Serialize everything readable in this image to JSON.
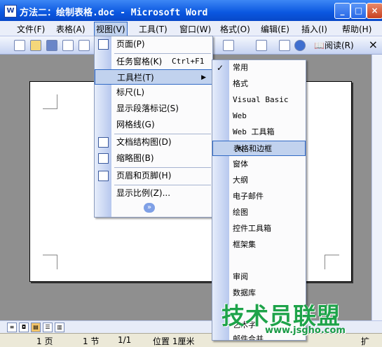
{
  "window": {
    "title": "方法二：绘制表格.doc - Microsoft Word",
    "app_icon": "W"
  },
  "menubar": [
    "文件(F)",
    "表格(A)",
    "视图(V)",
    "工具(T)",
    "窗口(W)",
    "格式(O)",
    "编辑(E)",
    "插入(I)",
    "帮助(H)"
  ],
  "toolbar": {
    "read_label": "阅读(R)",
    "close_symbol": "×"
  },
  "view_menu": {
    "items": [
      {
        "label": "页面(P)"
      },
      {
        "label": "任务窗格(K)",
        "shortcut": "Ctrl+F1"
      },
      {
        "label": "工具栏(T)"
      },
      {
        "label": "标尺(L)"
      },
      {
        "label": "显示段落标记(S)"
      },
      {
        "label": "网格线(G)"
      },
      {
        "label": "文档结构图(D)"
      },
      {
        "label": "缩略图(B)"
      },
      {
        "label": "页眉和页脚(H)"
      },
      {
        "label": "显示比例(Z)..."
      }
    ],
    "expand_symbol": "»"
  },
  "toolbars_submenu": {
    "items": [
      "常用",
      "格式",
      "Visual Basic",
      "Web",
      "Web 工具箱",
      "表格和边框",
      "窗体",
      "大纲",
      "电子邮件",
      "绘图",
      "控件工具箱",
      "框架集",
      "审阅",
      "数据库",
      "艺术字",
      "邮件合并"
    ],
    "checked": "常用",
    "highlighted": "表格和边框"
  },
  "statusbar": {
    "page": "1 页",
    "section": "1 节",
    "pages": "1/1",
    "position": "位置 1厘米",
    "ext": "扩"
  },
  "watermark": {
    "text": "技术员联盟",
    "url": "www.jsgho.com"
  },
  "colors": {
    "title_bar": "#0a57e0",
    "menu_highlight": "#c1d2ee",
    "highlight_border": "#316ac5",
    "watermark": "#1ea34a"
  }
}
